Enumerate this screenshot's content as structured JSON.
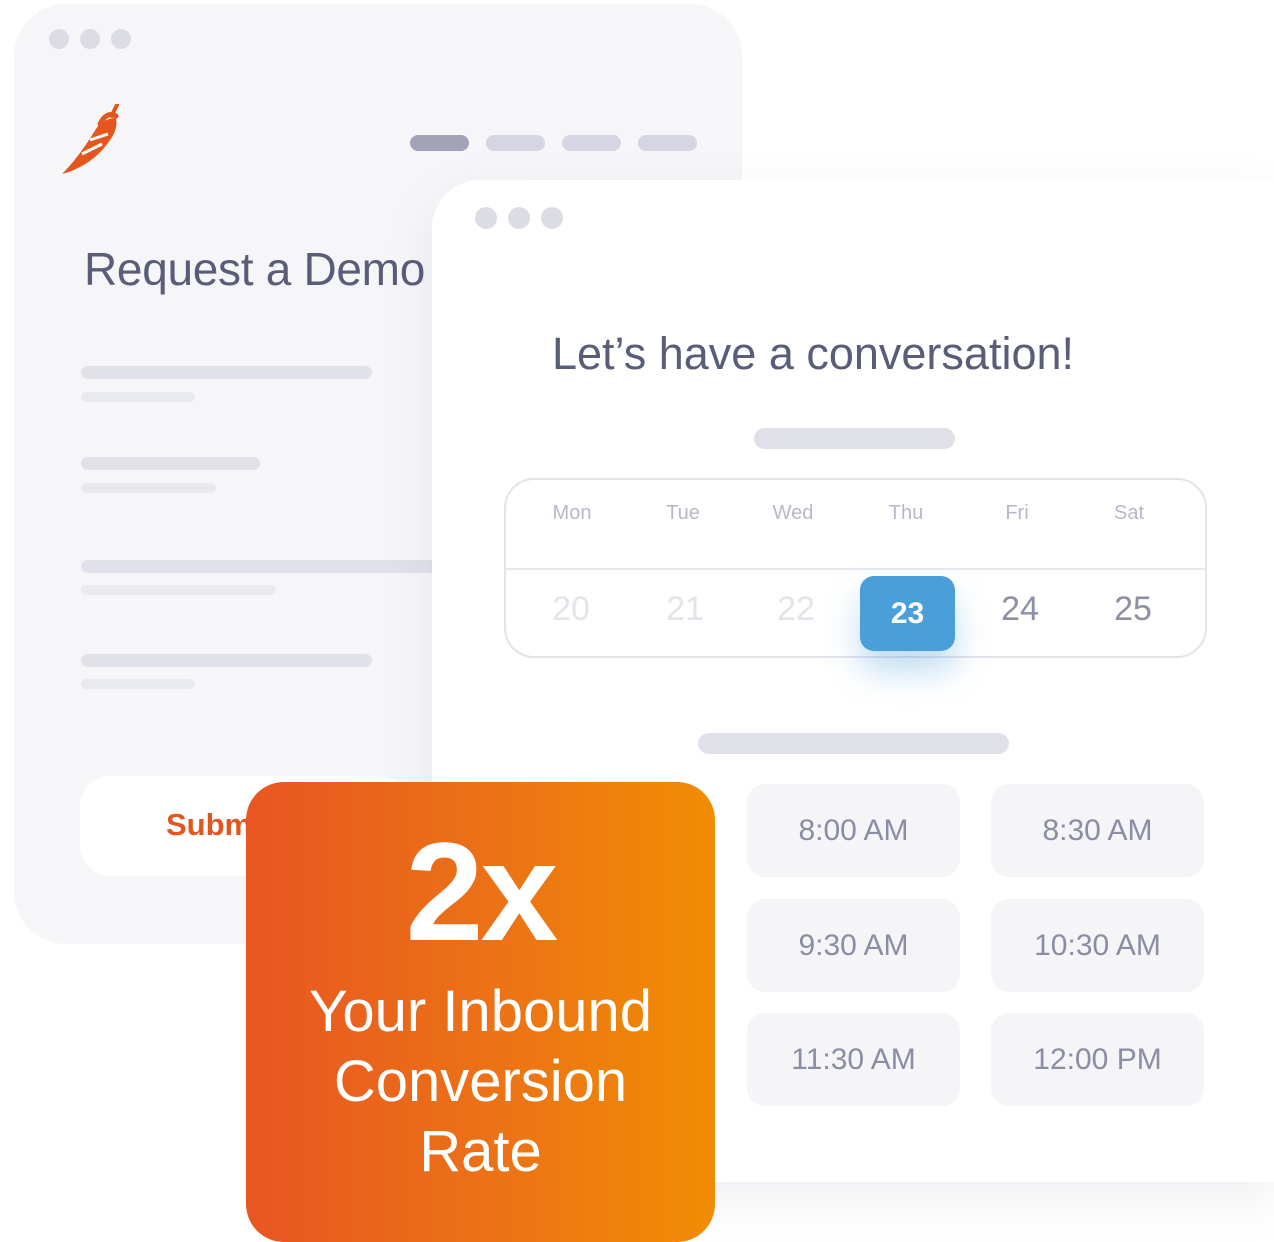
{
  "form_window": {
    "title": "Request a Demo",
    "submit_label": "Submit"
  },
  "scheduler_window": {
    "title": "Let’s have a conversation!",
    "calendar": {
      "day_names": [
        "Mon",
        "Tue",
        "Wed",
        "Thu",
        "Fri",
        "Sat"
      ],
      "dates": [
        "20",
        "21",
        "22",
        "23",
        "24",
        "25"
      ],
      "selected_date": "23"
    },
    "time_slots": [
      "8:00 AM",
      "8:30 AM",
      "9:30 AM",
      "10:30 AM",
      "11:30 AM",
      "12:00 PM"
    ]
  },
  "stat_card": {
    "value": "2x",
    "label": "Your Inbound Conversion Rate"
  },
  "colors": {
    "brand_orange": "#e85621",
    "accent_blue": "#4a9fd8"
  }
}
